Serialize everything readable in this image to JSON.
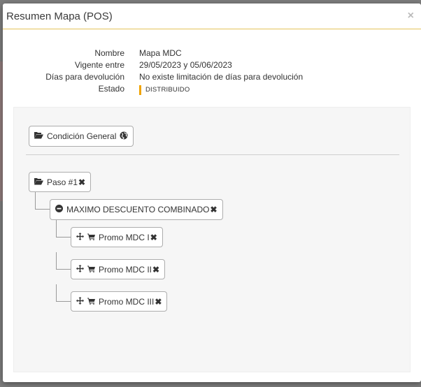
{
  "modal": {
    "title": "Resumen Mapa (POS)",
    "close_symbol": "×"
  },
  "info": {
    "rows": [
      {
        "label": "Nombre",
        "value": "Mapa MDC"
      },
      {
        "label": "Vigente entre",
        "value": "29/05/2023 y 05/06/2023"
      },
      {
        "label": "Días para devolución",
        "value": "No existe limitación de días para devolución"
      }
    ],
    "status_label": "Estado",
    "status_value": "DISTRIBUIDO",
    "status_color": "#f0a400"
  },
  "tree": {
    "general_condition": {
      "label": "Condición General",
      "icons": [
        "folder-open-icon",
        "globe-icon"
      ]
    },
    "step": {
      "label": "Paso #1",
      "remove_symbol": "✖"
    },
    "group": {
      "label": "MAXIMO DESCUENTO COMBINADO",
      "remove_symbol": "✖"
    },
    "promos": [
      {
        "label": "Promo MDC I",
        "remove_symbol": "✖"
      },
      {
        "label": "Promo MDC II",
        "remove_symbol": "✖"
      },
      {
        "label": "Promo MDC III",
        "remove_symbol": "✖"
      }
    ]
  }
}
